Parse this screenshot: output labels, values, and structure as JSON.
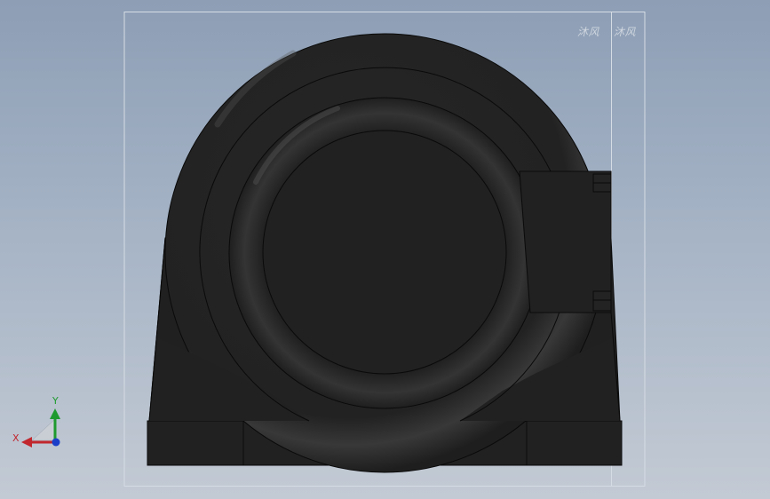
{
  "viewport": {
    "background_top": "#8d9eb5",
    "background_bottom": "#c3cad4"
  },
  "model": {
    "color": "#212121",
    "edge_color": "#0a0a0a"
  },
  "watermarks": [
    "沐风",
    "沐风"
  ],
  "triad": {
    "x_label": "X",
    "y_label": "Y",
    "x_color": "#c1272d",
    "y_color": "#1f9a2e",
    "z_color": "#1c3fc9"
  }
}
